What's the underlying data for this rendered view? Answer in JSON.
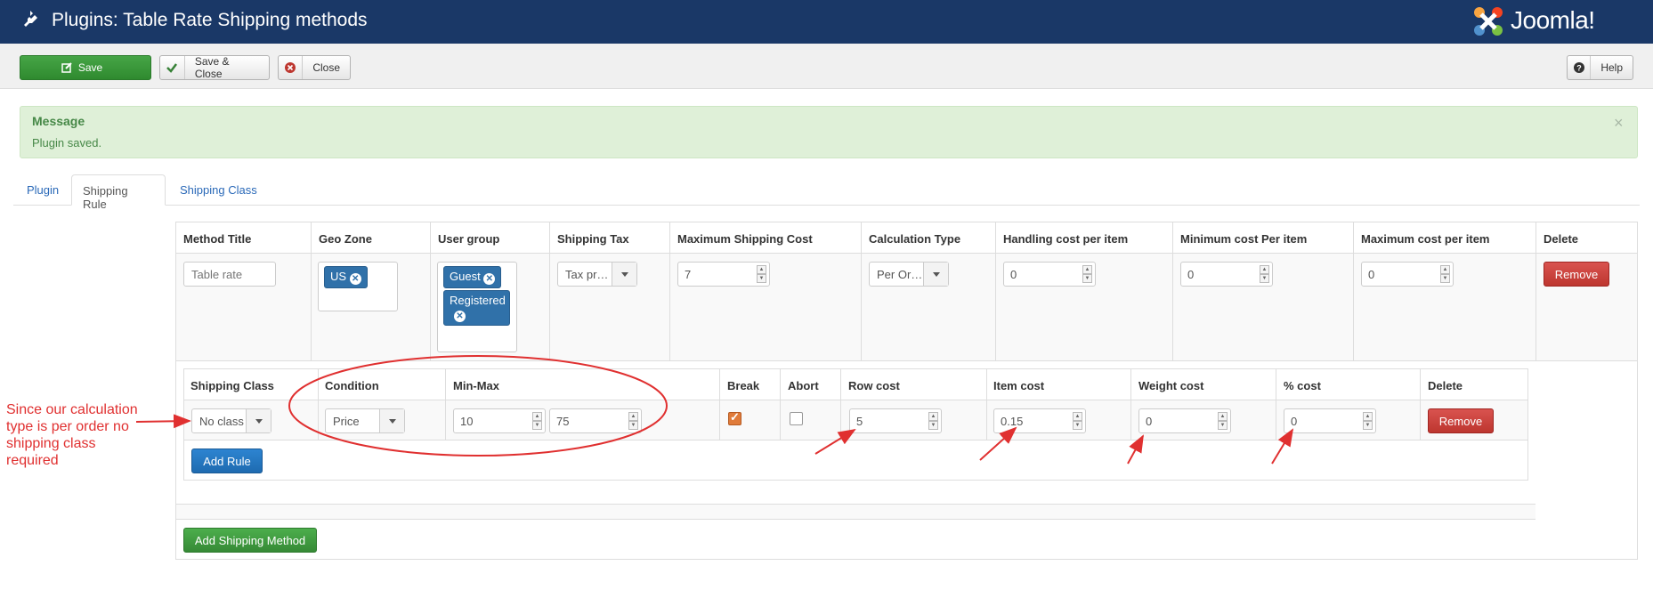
{
  "header": {
    "title": "Plugins: Table Rate Shipping methods",
    "brand": "Joomla!"
  },
  "toolbar": {
    "save": "Save",
    "save_close": "Save & Close",
    "close": "Close",
    "help": "Help"
  },
  "message": {
    "heading": "Message",
    "body": "Plugin saved.",
    "close": "×"
  },
  "tabs": [
    "Plugin",
    "Shipping Rule",
    "Shipping Class"
  ],
  "method": {
    "headers": [
      "Method Title",
      "Geo Zone",
      "User group",
      "Shipping Tax",
      "Maximum Shipping Cost",
      "Calculation Type",
      "Handling cost per item",
      "Minimum cost Per item",
      "Maximum cost per item",
      "Delete"
    ],
    "title_placeholder": "Table rate",
    "geo_zones": [
      "US"
    ],
    "user_groups": [
      "Guest",
      "Registered"
    ],
    "shipping_tax": "Tax pr…",
    "max_shipping_cost": "7",
    "calculation_type": "Per Or…",
    "handling_cost": "0",
    "min_cost": "0",
    "max_cost": "0",
    "remove": "Remove"
  },
  "rule": {
    "headers": [
      "Shipping Class",
      "Condition",
      "Min-Max",
      "Break",
      "Abort",
      "Row cost",
      "Item cost",
      "Weight cost",
      "% cost",
      "Delete"
    ],
    "shipping_class": "No class",
    "condition": "Price",
    "min": "10",
    "max": "75",
    "break_checked": true,
    "abort_checked": false,
    "row_cost": "5",
    "item_cost": "0.15",
    "weight_cost": "0",
    "percent_cost": "0",
    "remove": "Remove",
    "add_rule": "Add Rule"
  },
  "add_method": "Add Shipping Method",
  "annotation": "Since our calculation type is per order no shipping class required",
  "colors": {
    "header_bg": "#1a3867",
    "annotation": "#e03030",
    "success_bg": "#dff0d8"
  }
}
